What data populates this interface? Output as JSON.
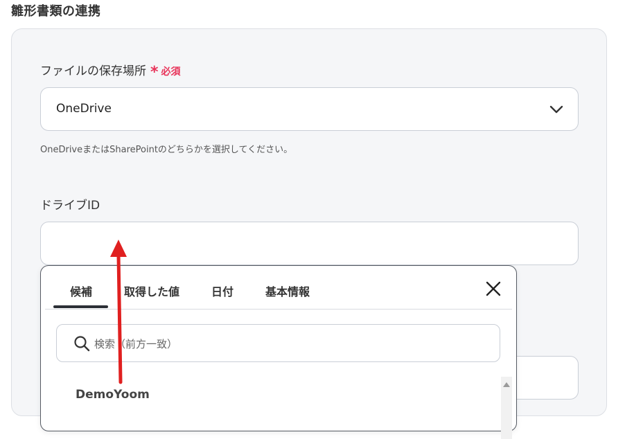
{
  "section": {
    "title": "雛形書類の連携"
  },
  "storage_field": {
    "label": "ファイルの保存場所",
    "required_mark": "*",
    "required_text": "必須",
    "selected_value": "OneDrive",
    "helper_text": "OneDriveまたはSharePointのどちらかを選択してください。"
  },
  "drive_field": {
    "label": "ドライブID",
    "value": ""
  },
  "popover": {
    "tabs": [
      {
        "label": "候補"
      },
      {
        "label": "取得した値"
      },
      {
        "label": "日付"
      },
      {
        "label": "基本情報"
      }
    ],
    "active_tab": "候補",
    "search": {
      "placeholder": "検索（前方一致）"
    },
    "options": [
      {
        "label": "DemoYoom"
      }
    ]
  },
  "colors": {
    "required": "#e8345a",
    "annotation_arrow": "#e02020",
    "panel_bg": "#f5f6f8"
  },
  "icons": [
    "chevron-down-icon",
    "close-icon",
    "search-icon",
    "scroll-up-icon"
  ]
}
